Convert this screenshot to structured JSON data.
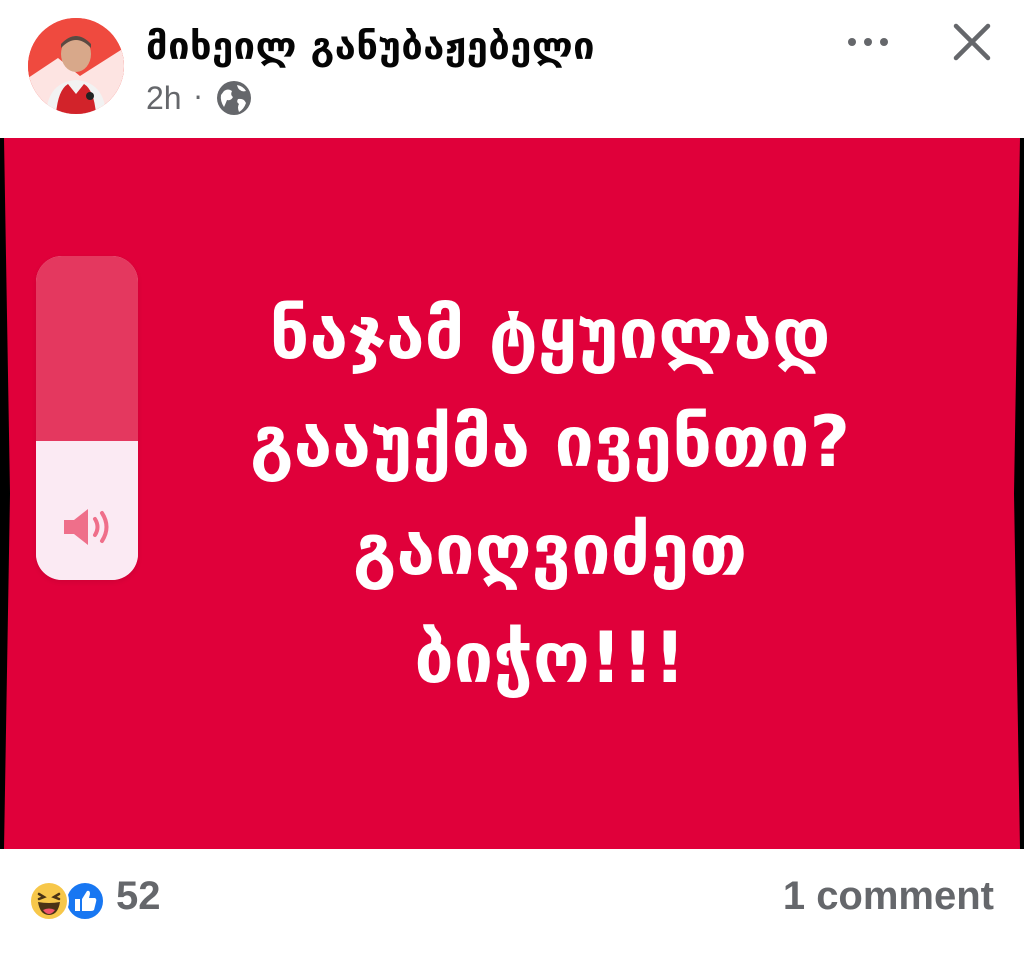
{
  "post": {
    "author": "მიხეილ განუბაჟებელი",
    "time": "2h",
    "separator": "·",
    "privacy_icon": "globe-icon",
    "menu_icon": "more-icon",
    "close_icon": "close-icon",
    "image_background": "#e0003a",
    "image_text": {
      "line1": "ნაჯამ ტყუილად",
      "line2": "გააუქმა ივენთი?",
      "line3": "გაიღვიძეთ",
      "line4": "ბიჭო!!!"
    }
  },
  "volume_hud": {
    "icon": "speaker-icon",
    "level_percent": 43
  },
  "footer": {
    "reaction_icons": [
      "haha-reaction-icon",
      "like-reaction-icon"
    ],
    "reaction_count": "52",
    "comments": "1 comment"
  },
  "colors": {
    "accent_red": "#e0003a",
    "like_blue": "#1877f2",
    "muted_text": "#65676b"
  }
}
